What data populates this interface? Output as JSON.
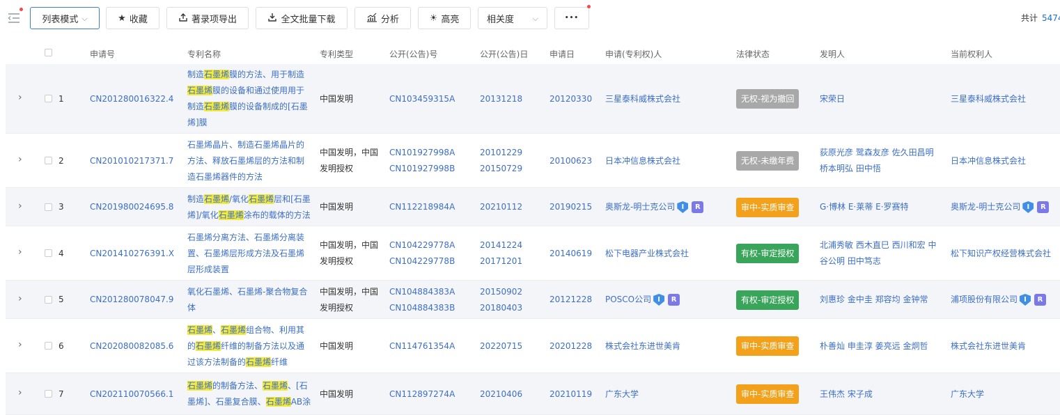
{
  "toolbar": {
    "view_mode": "列表模式",
    "favorite": "收藏",
    "export": "著录项导出",
    "bulk_download": "全文批量下载",
    "analyze": "分析",
    "highlight": "高亮",
    "sort": "相关度",
    "more": "•••",
    "total_label": "共计",
    "total_value": "5474"
  },
  "columns": {
    "app_no": "申请号",
    "title": "专利名称",
    "type": "专利类型",
    "pub_no": "公开(公告)号",
    "pub_date": "公开(公告)日",
    "app_date": "申请日",
    "applicant": "申请(专利权)人",
    "legal": "法律状态",
    "inventor": "发明人",
    "owner": "当前权利人"
  },
  "rows": [
    {
      "idx": "1",
      "app_no": "CN201280016322.4",
      "title_lines": [
        "制造[石墨烯]膜的方法、用于制造",
        "[石墨烯]膜的设备和通过使用用于",
        "制造[石墨烯]膜的设备制成的[石墨",
        "烯]膜"
      ],
      "type_lines": [
        "中国发明"
      ],
      "pub_no_lines": [
        "CN103459315A"
      ],
      "pub_date_lines": [
        "20131218"
      ],
      "app_date": "20120330",
      "applicant": "三星泰科威株式会社",
      "legal": "无权-视为撤回",
      "legal_color": "gray",
      "inventor_lines": [
        "宋荣日"
      ],
      "owner": "三星泰科威株式会社"
    },
    {
      "idx": "2",
      "app_no": "CN201010217371.7",
      "title_lines": [
        "石墨烯晶片、制造石墨烯晶片的",
        "方法、释放石墨烯层的方法和制",
        "造石墨烯器件的方法"
      ],
      "type_lines": [
        "中国发明，中国",
        "发明授权"
      ],
      "pub_no_lines": [
        "CN101927998A",
        "CN101927998B"
      ],
      "pub_date_lines": [
        "20101229",
        "20150729"
      ],
      "app_date": "20100623",
      "applicant": "日本冲信息株式会社",
      "legal": "无权-未缴年费",
      "legal_color": "gray",
      "inventor_lines": [
        "荻原光彦 鹭森友彦 佐久田昌明",
        "桥本明弘 田中悟"
      ],
      "owner": "日本冲信息株式会社"
    },
    {
      "idx": "3",
      "app_no": "CN201980024695.8",
      "title_lines": [
        "制造[石墨烯]/氧化[石墨烯]层和[石墨",
        "烯]/氧化[石墨烯]涂布的载体的方法"
      ],
      "type_lines": [
        "中国发明"
      ],
      "pub_no_lines": [
        "CN112218984A"
      ],
      "pub_date_lines": [
        "20210112"
      ],
      "app_date": "20190215",
      "applicant": "奥斯龙-明士克公司",
      "legal": "审中-实质审查",
      "legal_color": "orange",
      "inventor_lines": [
        "G·博林 E·莱蒂 E·罗赛特"
      ],
      "owner": "奥斯龙-明士克公司"
    },
    {
      "idx": "4",
      "app_no": "CN201410276391.X",
      "title_lines": [
        "石墨烯分离方法、石墨烯分离装",
        "置、石墨烯层形成方法及石墨烯",
        "层形成装置"
      ],
      "type_lines": [
        "中国发明，中国",
        "发明授权"
      ],
      "pub_no_lines": [
        "CN104229778A",
        "CN104229778B"
      ],
      "pub_date_lines": [
        "20141224",
        "20171201"
      ],
      "app_date": "20140619",
      "applicant": "松下电器产业株式会社",
      "legal": "有权-审定授权",
      "legal_color": "green",
      "inventor_lines": [
        "北浦秀敏 西木直巳 西川和宏 中",
        "谷公明 田中笃志"
      ],
      "owner": "松下知识产权经营株式会社"
    },
    {
      "idx": "5",
      "app_no": "CN201280078047.9",
      "title_lines": [
        "氧化石墨烯、石墨烯-聚合物复合",
        "体"
      ],
      "type_lines": [
        "中国发明，中国",
        "发明授权"
      ],
      "pub_no_lines": [
        "CN104884383A",
        "CN104884383B"
      ],
      "pub_date_lines": [
        "20150902",
        "20180403"
      ],
      "app_date": "20121228",
      "applicant": "POSCO公司",
      "legal": "有权-审定授权",
      "legal_color": "green",
      "inventor_lines": [
        "刘惠珍 金中圭 郑容均 金钟常"
      ],
      "owner": "浦项股份有限公司"
    },
    {
      "idx": "6",
      "app_no": "CN202080082085.6",
      "title_lines": [
        "[石墨烯]、[石墨烯]组合物、利用其",
        "的[石墨烯]纤维的制备方法以及通",
        "过该方法制备的[石墨烯]纤维"
      ],
      "type_lines": [
        "中国发明"
      ],
      "pub_no_lines": [
        "CN114761354A"
      ],
      "pub_date_lines": [
        "20220715"
      ],
      "app_date": "20201228",
      "applicant": "株式会社东进世美肯",
      "legal": "审中-实质审查",
      "legal_color": "orange",
      "inventor_lines": [
        "朴善灿 申圭淳 姜亮远 金炯哲"
      ],
      "owner": "株式会社东进世美肯"
    },
    {
      "idx": "7",
      "app_no": "CN202110070566.1",
      "title_lines": [
        "[石墨烯]的制备方法、[石墨烯]、[石",
        "墨烯]、石墨复合膜、[石墨烯]AB涂"
      ],
      "type_lines": [
        "中国发明"
      ],
      "pub_no_lines": [
        "CN112897274A"
      ],
      "pub_date_lines": [
        "20210406"
      ],
      "app_date": "20210119",
      "applicant": "广东大学",
      "legal": "审中-实质审查",
      "legal_color": "orange",
      "inventor_lines": [
        "王伟杰 宋子成"
      ],
      "owner": "广东大学"
    }
  ],
  "badges": {
    "i": "I",
    "r": "R"
  }
}
